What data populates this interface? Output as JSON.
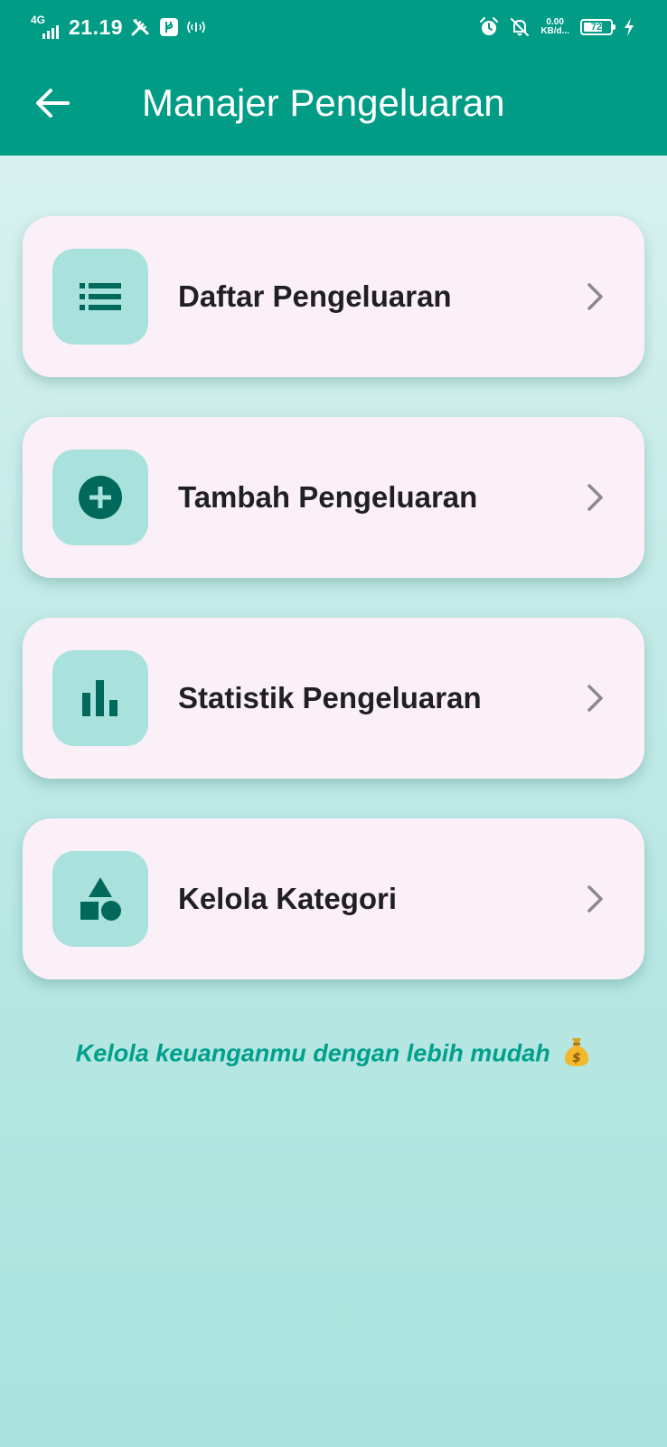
{
  "status_bar": {
    "network": "4G",
    "time": "21.19",
    "net_speed_value": "0.00",
    "net_speed_unit": "KB/d...",
    "battery_percent": "72",
    "battery_level": 0.72,
    "icons": [
      "signal-icon",
      "tools-icon",
      "usb-icon",
      "hotspot-icon",
      "alarm-icon",
      "bell-off-icon",
      "battery-icon",
      "charging-icon"
    ]
  },
  "app_bar": {
    "title": "Manajer Pengeluaran",
    "back_icon": "arrow-left-icon"
  },
  "menu": {
    "items": [
      {
        "label": "Daftar Pengeluaran",
        "icon": "list-icon"
      },
      {
        "label": "Tambah Pengeluaran",
        "icon": "add-circle-icon"
      },
      {
        "label": "Statistik Pengeluaran",
        "icon": "bar-chart-icon"
      },
      {
        "label": "Kelola Kategori",
        "icon": "category-shapes-icon"
      }
    ],
    "chevron_icon": "chevron-right-icon"
  },
  "footer": {
    "tagline": "Kelola keuanganmu dengan lebih mudah",
    "tagline_emoji": "money-bag-icon"
  },
  "colors": {
    "primary": "#009c86",
    "icon_tile": "#a9e2dd",
    "icon_glyph": "#00695c",
    "card_bg": "#fbf0f8",
    "tagline": "#00a08c"
  }
}
